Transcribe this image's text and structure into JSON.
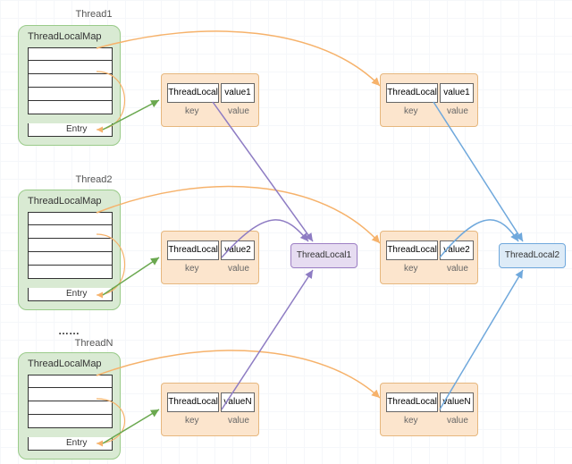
{
  "threads": [
    {
      "title": "Thread1",
      "mapLabel": "ThreadLocalMap",
      "entry": "Entry"
    },
    {
      "title": "Thread2",
      "mapLabel": "ThreadLocalMap",
      "entry": "Entry"
    },
    {
      "title": "ThreadN",
      "mapLabel": "ThreadLocalMap",
      "entry": "Entry"
    }
  ],
  "ellipsis": "……",
  "entriesLeft": [
    {
      "key": "ThreadLocal",
      "val": "value1",
      "keyLabel": "key",
      "valLabel": "value"
    },
    {
      "key": "ThreadLocal",
      "val": "value2",
      "keyLabel": "key",
      "valLabel": "value"
    },
    {
      "key": "ThreadLocal",
      "val": "valueN",
      "keyLabel": "key",
      "valLabel": "value"
    }
  ],
  "entriesRight": [
    {
      "key": "ThreadLocal",
      "val": "value1",
      "keyLabel": "key",
      "valLabel": "value"
    },
    {
      "key": "ThreadLocal",
      "val": "value2",
      "keyLabel": "key",
      "valLabel": "value"
    },
    {
      "key": "ThreadLocal",
      "val": "valueN",
      "keyLabel": "key",
      "valLabel": "value"
    }
  ],
  "tl1": "ThreadLocal1",
  "tl2": "ThreadLocal2",
  "colors": {
    "orange": "#f6b26b",
    "green": "#6aa84f",
    "purple": "#8e7cc3",
    "blue": "#6fa8dc"
  }
}
